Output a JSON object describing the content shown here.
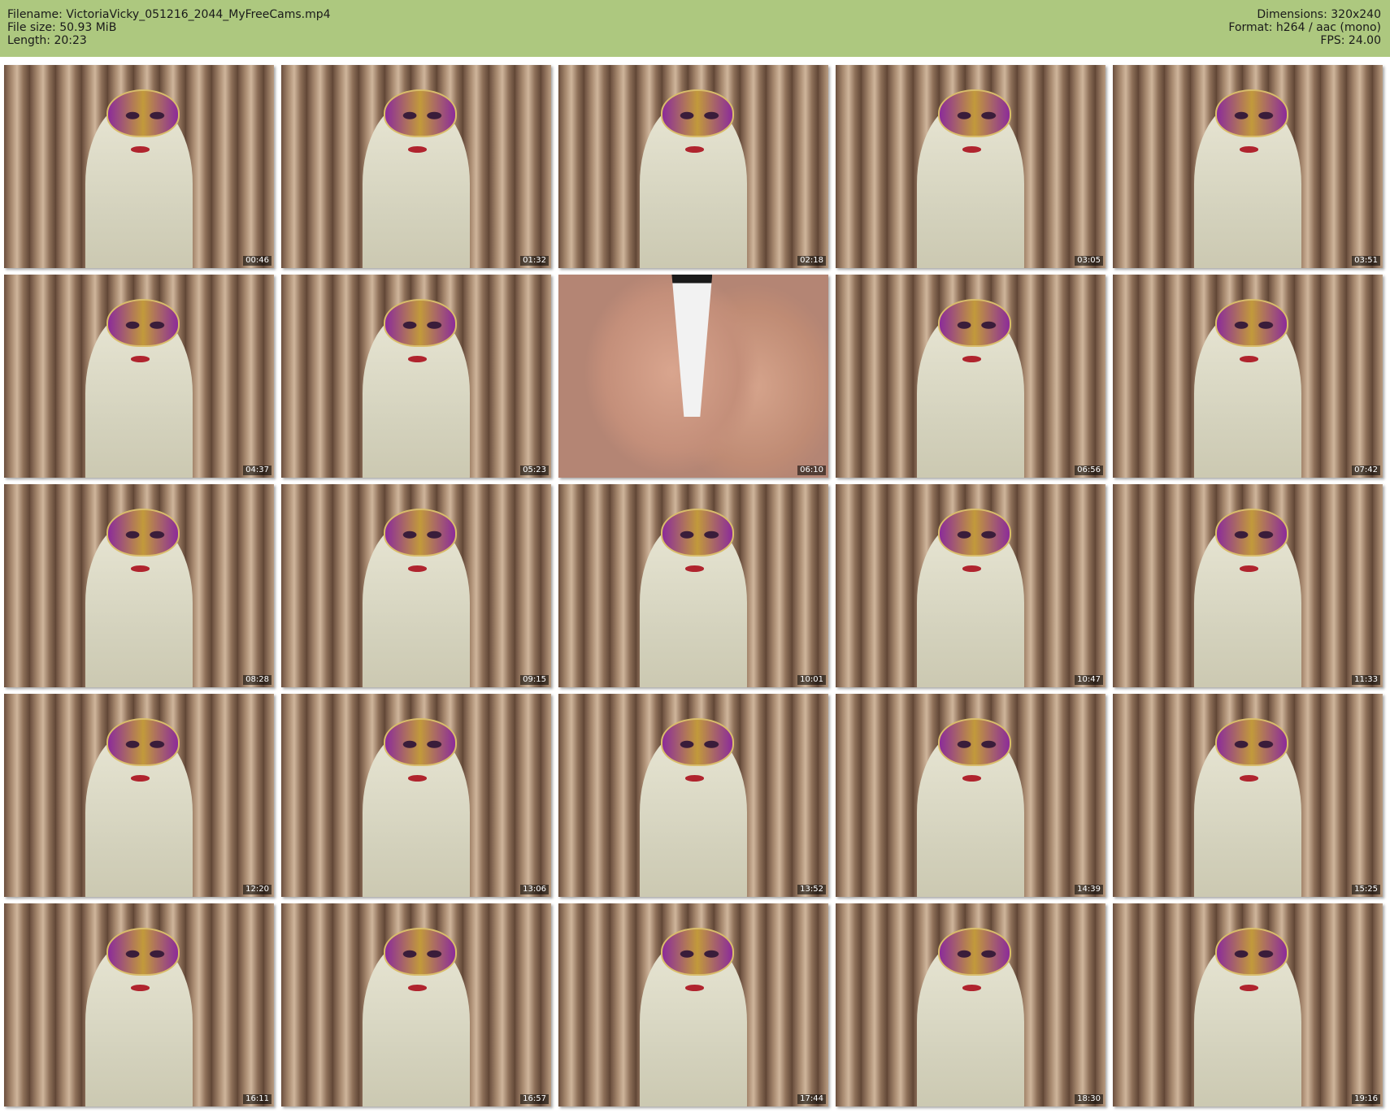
{
  "header": {
    "filename_label": "Filename:",
    "filename": "VictoriaVicky_051216_2044_MyFreeCams.mp4",
    "filesize_label": "File size:",
    "filesize": "50.93 MiB",
    "length_label": "Length:",
    "length": "20:23",
    "dimensions_label": "Dimensions:",
    "dimensions": "320x240",
    "format_label": "Format:",
    "format": "h264 / aac (mono)",
    "fps_label": "FPS:",
    "fps": "24.00"
  },
  "colors": {
    "header_bg": "#adc87f",
    "page_bg": "#ffffff"
  },
  "thumbnails": [
    {
      "time": "00:46",
      "scene": "portrait"
    },
    {
      "time": "01:32",
      "scene": "portrait"
    },
    {
      "time": "02:18",
      "scene": "portrait"
    },
    {
      "time": "03:05",
      "scene": "portrait"
    },
    {
      "time": "03:51",
      "scene": "portrait"
    },
    {
      "time": "04:37",
      "scene": "portrait"
    },
    {
      "time": "05:23",
      "scene": "portrait"
    },
    {
      "time": "06:10",
      "scene": "closeup"
    },
    {
      "time": "06:56",
      "scene": "portrait"
    },
    {
      "time": "07:42",
      "scene": "portrait"
    },
    {
      "time": "08:28",
      "scene": "portrait"
    },
    {
      "time": "09:15",
      "scene": "portrait"
    },
    {
      "time": "10:01",
      "scene": "portrait"
    },
    {
      "time": "10:47",
      "scene": "portrait"
    },
    {
      "time": "11:33",
      "scene": "portrait"
    },
    {
      "time": "12:20",
      "scene": "portrait"
    },
    {
      "time": "13:06",
      "scene": "portrait"
    },
    {
      "time": "13:52",
      "scene": "portrait"
    },
    {
      "time": "14:39",
      "scene": "portrait"
    },
    {
      "time": "15:25",
      "scene": "portrait"
    },
    {
      "time": "16:11",
      "scene": "portrait"
    },
    {
      "time": "16:57",
      "scene": "portrait"
    },
    {
      "time": "17:44",
      "scene": "portrait"
    },
    {
      "time": "18:30",
      "scene": "portrait"
    },
    {
      "time": "19:16",
      "scene": "portrait"
    }
  ]
}
